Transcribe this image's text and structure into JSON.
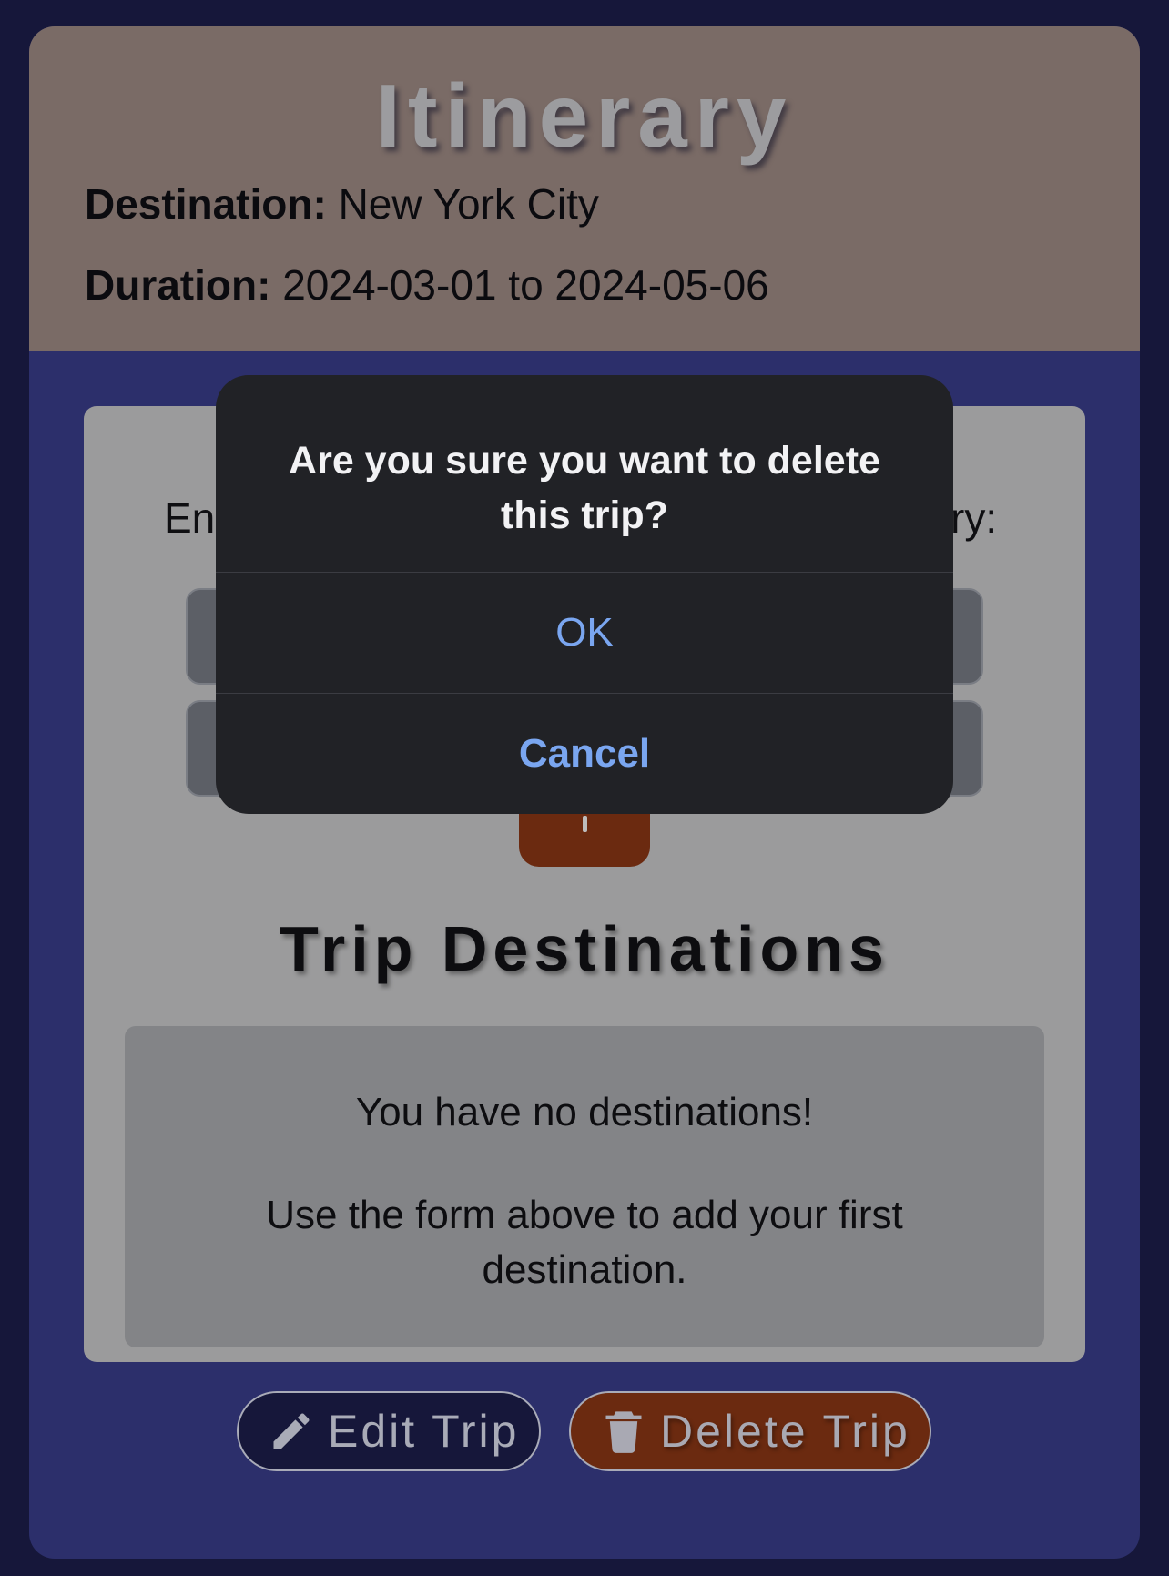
{
  "header": {
    "title": "Itinerary",
    "destination_label": "Destination:",
    "destination_value": "New York City",
    "duration_label": "Duration:",
    "duration_value": "2024-03-01 to 2024-05-06"
  },
  "form": {
    "label_left_fragment": "En",
    "label_right_fragment": "ry:"
  },
  "destinations": {
    "title": "Trip Destinations",
    "empty_message": "You have no destinations!",
    "empty_hint": "Use the form above to add your first destination."
  },
  "actions": {
    "edit_label": "Edit Trip",
    "delete_label": "Delete Trip",
    "edit_icon": "pencil-icon",
    "delete_icon": "trash-icon"
  },
  "dialog": {
    "message": "Are you sure you want to delete this trip?",
    "ok_label": "OK",
    "cancel_label": "Cancel"
  },
  "colors": {
    "page_bg": "#16173a",
    "card_bg": "#2c2f6b",
    "header_bg": "#7a6b66",
    "panel_bg": "#9b9b9c",
    "delete_bg": "#6b2a10",
    "dialog_bg": "#212226",
    "dialog_button": "#7aa6f0"
  }
}
